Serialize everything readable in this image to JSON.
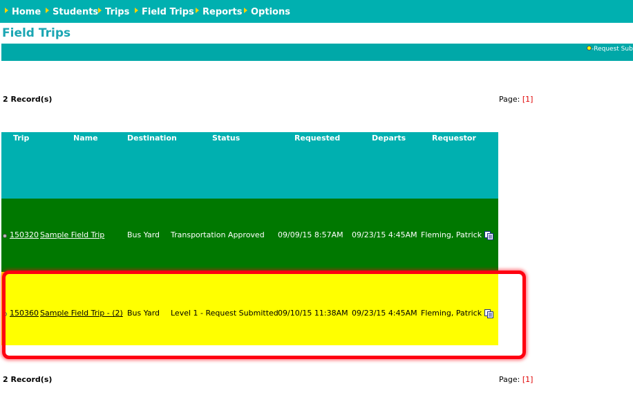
{
  "nav": {
    "items": [
      "Home",
      "Students",
      "Trips",
      "Field Trips",
      "Reports",
      "Options"
    ]
  },
  "page": {
    "title": "Field Trips"
  },
  "legend": {
    "request_submitted": "-Request Sub"
  },
  "records": {
    "top": "2 Record(s)",
    "bottom": "2 Record(s)"
  },
  "pager": {
    "label": "Page:",
    "current": "[1]"
  },
  "table": {
    "headers": [
      "Trip",
      "Name",
      "Destination",
      "Status",
      "Requested",
      "Departs",
      "Requestor"
    ],
    "rows": [
      {
        "trip": "150320",
        "name": "Sample Field Trip",
        "destination": "Bus Yard",
        "status": "Transportation Approved",
        "requested": "09/09/15 8:57AM",
        "departs": "09/23/15 4:45AM",
        "requestor": "Fleming, Patrick"
      },
      {
        "trip": "150360",
        "name": "Sample Field Trip - (2)",
        "destination": "Bus Yard",
        "status": "Level 1 - Request Submitted",
        "requested": "09/10/15 11:38AM",
        "departs": "09/23/15 4:45AM",
        "requestor": "Fleming, Patrick"
      }
    ]
  },
  "colors": {
    "nav_bg": "#00b0b0",
    "title": "#1ba6b3",
    "approved_row": "#007800",
    "submitted_row": "#ffff00",
    "highlight": "#ff0010",
    "pager_number": "#e00000"
  },
  "icons": [
    "nav-arrow-icon",
    "status-dot-icon",
    "copy-icon"
  ]
}
